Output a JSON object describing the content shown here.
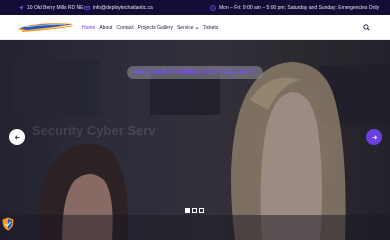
{
  "topbar": {
    "address": "10 Old Berry Mills RD NE",
    "email": "info@deploytechatlantic.ca",
    "hours": "Mon – Fri: 9:00 am – 5:00 pm; Saturday and Sunday: Emergencies Only",
    "accent": "#7d4dff"
  },
  "nav": {
    "items": [
      {
        "label": "Home",
        "active": true
      },
      {
        "label": "About"
      },
      {
        "label": "Contact"
      },
      {
        "label": "Projects Gallery"
      },
      {
        "label": "Service"
      },
      {
        "label": "Tickets"
      }
    ],
    "active_color": "#6a3fe0"
  },
  "hero": {
    "welcome": "WELCOME TO DEPLOYTECH ATLANTIC!",
    "ghost_text": "Security Cyber Serv",
    "slides": 3,
    "active_slide": 1,
    "arrow_accent": "#6a3fe0"
  },
  "icons": {
    "address": "location-arrow-icon",
    "email": "mail-icon",
    "hours": "clock-icon",
    "search": "search-icon",
    "prev": "arrow-left-icon",
    "next": "arrow-right-icon",
    "badge": "shield-badge-icon"
  }
}
